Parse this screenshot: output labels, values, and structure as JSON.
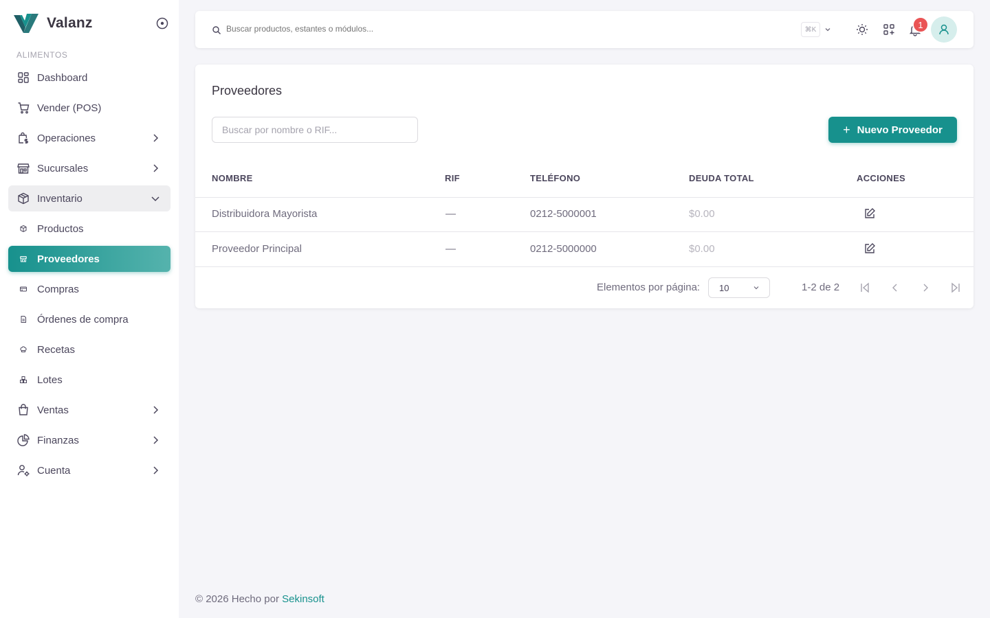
{
  "brand": {
    "name": "Valanz"
  },
  "sidebar": {
    "section": "ALIMENTOS",
    "items": [
      {
        "label": "Dashboard"
      },
      {
        "label": "Vender (POS)"
      },
      {
        "label": "Operaciones"
      },
      {
        "label": "Sucursales"
      },
      {
        "label": "Inventario"
      },
      {
        "label": "Productos"
      },
      {
        "label": "Proveedores"
      },
      {
        "label": "Compras"
      },
      {
        "label": "Órdenes de compra"
      },
      {
        "label": "Recetas"
      },
      {
        "label": "Lotes"
      },
      {
        "label": "Ventas"
      },
      {
        "label": "Finanzas"
      },
      {
        "label": "Cuenta"
      }
    ]
  },
  "header": {
    "search_placeholder": "Buscar productos, estantes o módulos...",
    "shortcut": "⌘K",
    "notifications_count": "1"
  },
  "page": {
    "title": "Proveedores",
    "filter_placeholder": "Buscar por nombre o RIF...",
    "add_button": "Nuevo Proveedor",
    "columns": [
      "NOMBRE",
      "RIF",
      "TELÉFONO",
      "DEUDA TOTAL",
      "ACCIONES"
    ],
    "rows": [
      {
        "name": "Distribuidora Mayorista",
        "rif": "—",
        "phone": "0212-5000001",
        "debt": "$0.00"
      },
      {
        "name": "Proveedor Principal",
        "rif": "—",
        "phone": "0212-5000000",
        "debt": "$0.00"
      }
    ],
    "pagination": {
      "per_page_label": "Elementos por página:",
      "per_page": "10",
      "range": "1-2 de 2"
    }
  },
  "footer": {
    "text": "© 2026 Hecho por ",
    "link": "Sekinsoft"
  },
  "colors": {
    "accent": "#17918d",
    "badge": "#ea5455"
  }
}
